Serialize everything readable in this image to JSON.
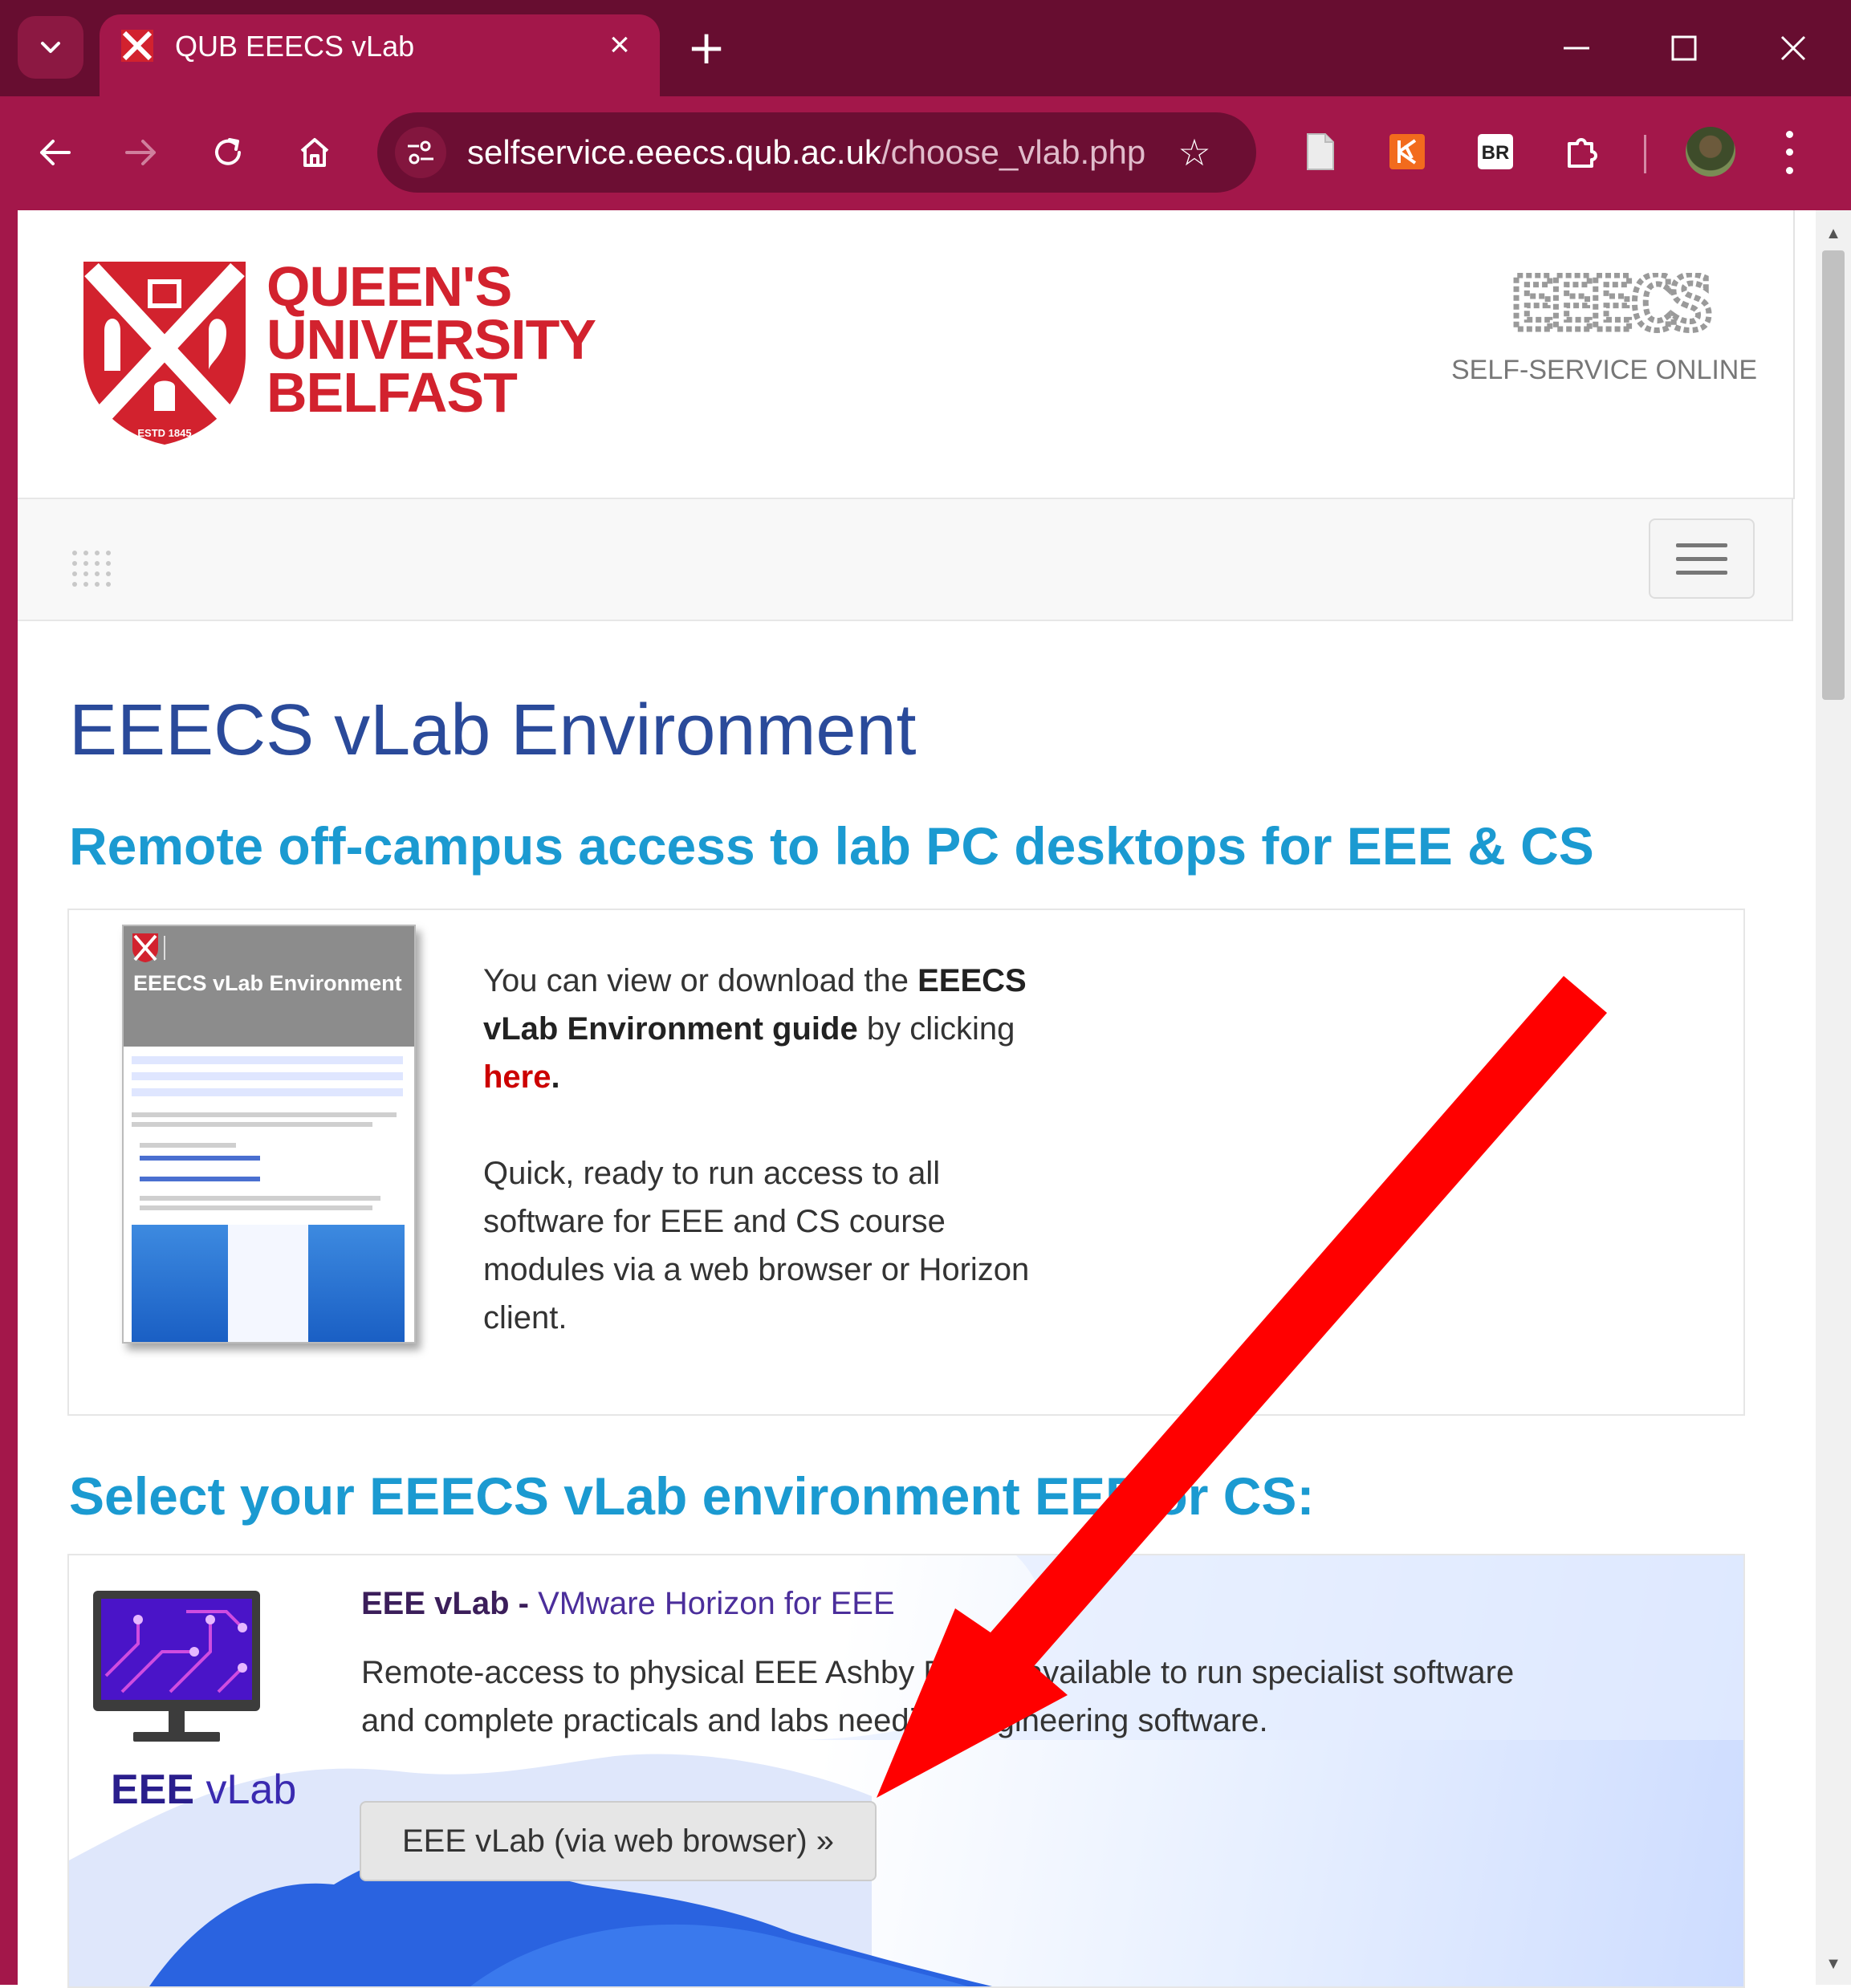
{
  "browser": {
    "tab_title": "QUB EEECS vLab",
    "url_host": "selfservice.eeecs.qub.ac.uk",
    "url_path": "/choose_vlab.php",
    "extensions": [
      "document-icon",
      "orange-extension-icon",
      "br-extension-icon",
      "puzzle-icon"
    ],
    "br_label": "BR",
    "theme_color": "#a3174a",
    "titlebar_color": "#670d30"
  },
  "header": {
    "logo_line1": "QUEEN'S",
    "logo_line2": "UNIVERSITY",
    "logo_line3": "BELFAST",
    "logo_estd": "ESTD 1845",
    "right_logo": "EEECS",
    "right_caption": "SELF-SERVICE ONLINE",
    "brand_red": "#d2222e"
  },
  "main": {
    "title": "EEECS vLab Environment",
    "subtitle": "Remote off-campus access to lab PC desktops for EEE & CS",
    "guide": {
      "thumbnail_title": "EEECS vLab Environment",
      "text_pre": "You can view or download the ",
      "text_bold": "EEECS vLab Environment guide",
      "text_mid": " by clicking ",
      "link": "here",
      "text_end": ".",
      "paragraph2": "Quick, ready to run access to all software for EEE and CS course modules via a web browser or Horizon client."
    },
    "select_heading": "Select your EEECS vLab environment EEE or CS:",
    "eee": {
      "logo_bold": "EEE",
      "logo_light": "vLab",
      "heading_bold": "EEE vLab - ",
      "heading_sub": "VMware Horizon for EEE",
      "description": "Remote-access to physical EEE Ashby PCs is available to run specialist software and complete practicals and labs needing engineering software.",
      "button": "EEE vLab (via web browser) »"
    }
  },
  "annotation": {
    "arrow_color": "#ff0000"
  }
}
